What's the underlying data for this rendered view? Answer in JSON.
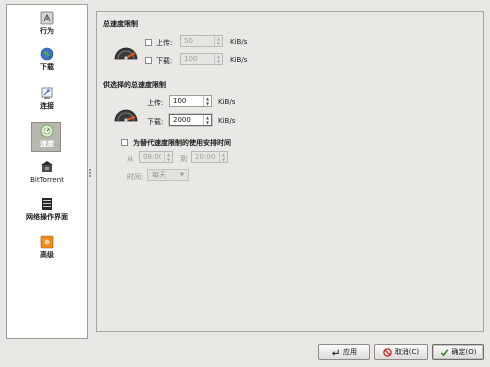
{
  "sidebar": {
    "items": [
      {
        "label": "行为",
        "icon": "behavior-icon"
      },
      {
        "label": "下载",
        "icon": "download-globe-icon"
      },
      {
        "label": "连接",
        "icon": "connection-icon"
      },
      {
        "label": "速度",
        "icon": "speed-icon",
        "selected": true
      },
      {
        "label": "BitTorrent",
        "icon": "bittorrent-icon"
      },
      {
        "label": "网络操作界面",
        "icon": "web-interface-icon"
      },
      {
        "label": "高级",
        "icon": "advanced-icon"
      }
    ]
  },
  "global_limit": {
    "title": "总速度限制",
    "upload_label": "上传:",
    "upload_value": "50",
    "download_label": "下载:",
    "download_value": "100",
    "unit": "KiB/s",
    "upload_enabled": false,
    "download_enabled": false
  },
  "alt_limit": {
    "title": "供选择的总速度限制",
    "upload_label": "上传:",
    "upload_value": "100",
    "download_label": "下载:",
    "download_value": "2000",
    "unit": "KiB/s",
    "schedule_checkbox_label": "为替代速度限制的使用安排时间",
    "schedule_enabled": false,
    "from_label": "从",
    "from_time": "08:00",
    "to_label": "到",
    "to_time": "20:00",
    "days_label": "时间:",
    "days_value": "每天"
  },
  "buttons": {
    "apply": "应用",
    "cancel": "取消(C)",
    "ok": "确定(O)"
  },
  "colors": {
    "selected_bg": "#b7b6b1",
    "panel_bg": "#e9e8e4",
    "gauge_needle": "#e2541b"
  }
}
